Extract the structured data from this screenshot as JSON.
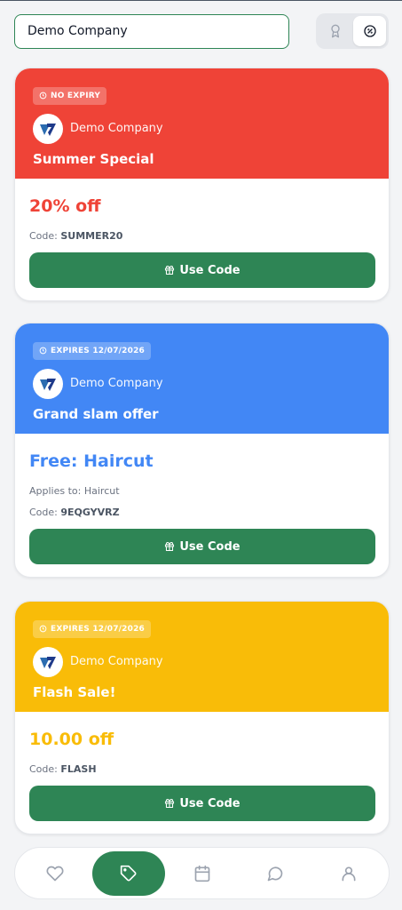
{
  "header": {
    "company_value": "Demo Company",
    "view_toggle": [
      {
        "icon": "award-icon",
        "active": false
      },
      {
        "icon": "discount-icon",
        "active": true
      }
    ]
  },
  "use_code_label": "Use Code",
  "offers": [
    {
      "badge": "NO EXPIRY",
      "brand": "Demo Company",
      "title": "Summer Special",
      "discount": "20% off",
      "applies_label": "",
      "applies_value": "",
      "code_label": "Code:",
      "code": "SUMMER20",
      "color": "#ef4337"
    },
    {
      "badge": "EXPIRES 12/07/2026",
      "brand": "Demo Company",
      "title": "Grand slam offer",
      "discount": "Free: Haircut",
      "applies_label": "Applies to:",
      "applies_value": "Haircut",
      "code_label": "Code:",
      "code": "9EQGYVRZ",
      "color": "#4287f5"
    },
    {
      "badge": "EXPIRES 12/07/2026",
      "brand": "Demo Company",
      "title": "Flash Sale!",
      "discount": "10.00 off",
      "applies_label": "",
      "applies_value": "",
      "code_label": "Code:",
      "code": "FLASH",
      "color": "#f9bc08"
    }
  ],
  "nav": [
    {
      "icon": "heart-icon",
      "active": false
    },
    {
      "icon": "tag-icon",
      "active": true
    },
    {
      "icon": "calendar-icon",
      "active": false
    },
    {
      "icon": "chat-icon",
      "active": false
    },
    {
      "icon": "user-icon",
      "active": false
    }
  ],
  "colors": {
    "accent": "#2e8555",
    "muted": "#6b7280"
  }
}
